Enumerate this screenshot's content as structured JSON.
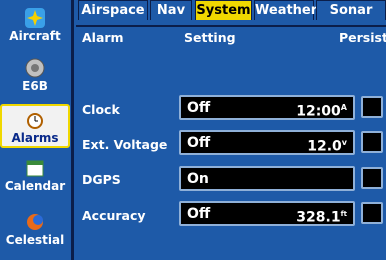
{
  "sidebar": {
    "items": [
      {
        "label": "Aircraft",
        "icon": "aircraft-icon"
      },
      {
        "label": "E6B",
        "icon": "e6b-icon"
      },
      {
        "label": "Alarms",
        "icon": "alarm-clock-icon",
        "active": true
      },
      {
        "label": "Calendar",
        "icon": "calendar-icon"
      },
      {
        "label": "Celestial",
        "icon": "celestial-icon"
      }
    ]
  },
  "tabs": [
    "Airspace",
    "Nav",
    "System",
    "Weather",
    "Sonar"
  ],
  "active_tab": "System",
  "columns": {
    "alarm": "Alarm",
    "setting": "Setting",
    "persist": "Persist"
  },
  "rows": [
    {
      "label": "Clock",
      "setting": "Off",
      "value": "12:00",
      "unit": "A"
    },
    {
      "label": "Ext. Voltage",
      "setting": "Off",
      "value": "12.0",
      "unit": "v"
    },
    {
      "label": "DGPS",
      "setting": "On",
      "value": "",
      "unit": ""
    },
    {
      "label": "Accuracy",
      "setting": "Off",
      "value": "328.1",
      "unit": "ft"
    }
  ],
  "colors": {
    "background": "#1e5aa8",
    "active_tab": "#f0d800",
    "field": "#000000"
  }
}
